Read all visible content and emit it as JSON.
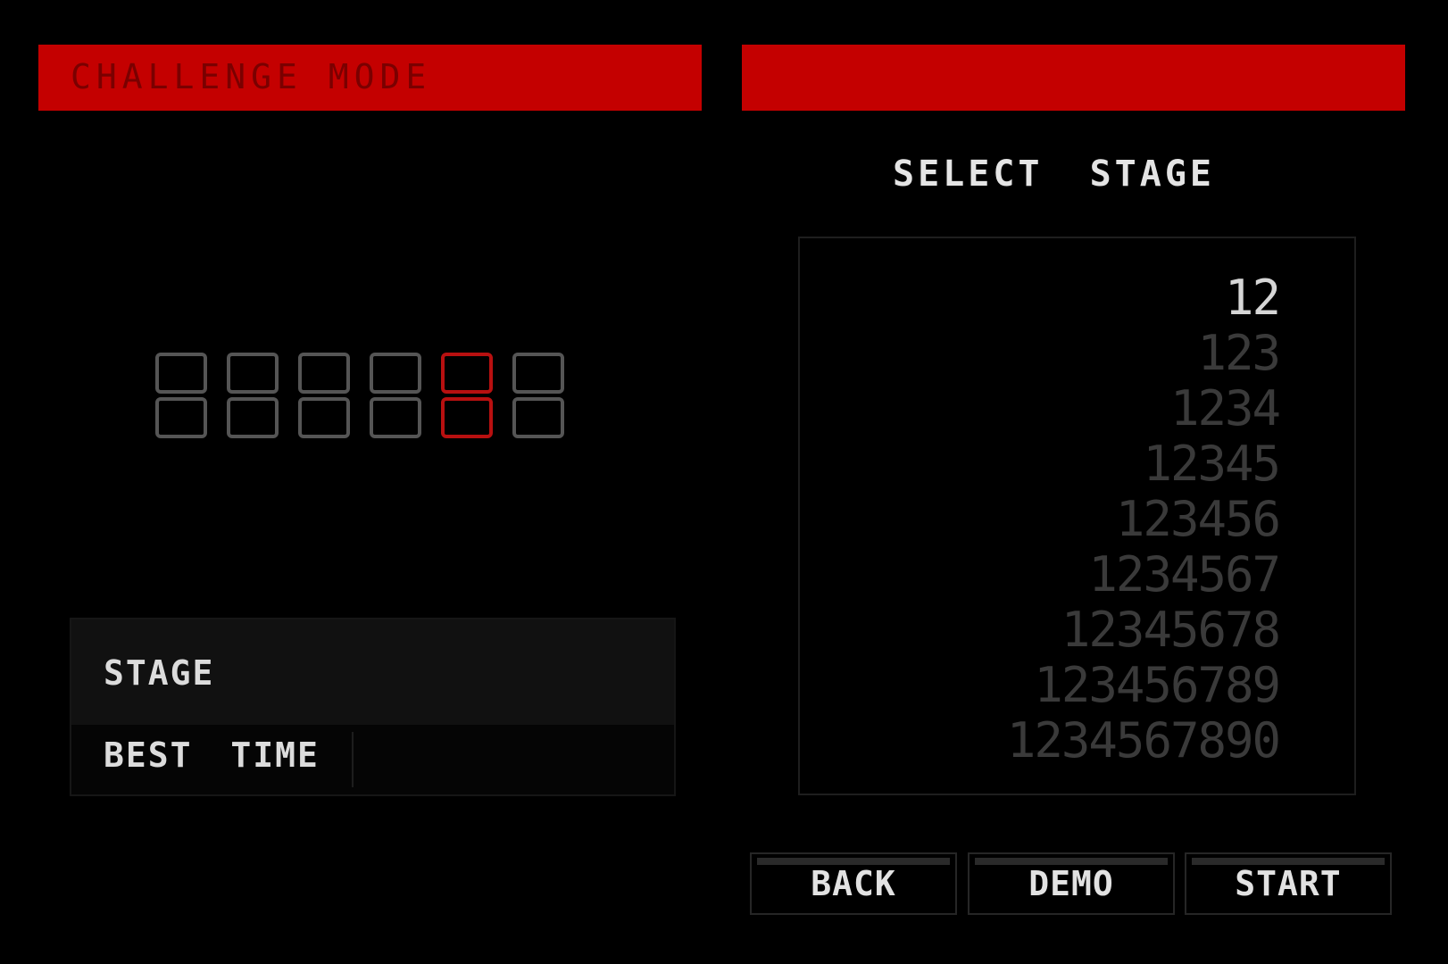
{
  "header": {
    "mode_title": "CHALLENGE MODE",
    "select_title": "SELECT STAGE"
  },
  "counter": {
    "digits": 6,
    "active_index": 4
  },
  "info_panel": {
    "stage_label": "STAGE",
    "best_time_label": "BEST TIME"
  },
  "stage_list": {
    "items": [
      "12",
      "123",
      "1234",
      "12345",
      "123456",
      "1234567",
      "12345678",
      "123456789",
      "1234567890"
    ],
    "selected_index": 0
  },
  "buttons": {
    "back": "BACK",
    "demo": "DEMO",
    "start": "START"
  },
  "colors": {
    "accent_red": "#c40000",
    "background": "#000000"
  }
}
